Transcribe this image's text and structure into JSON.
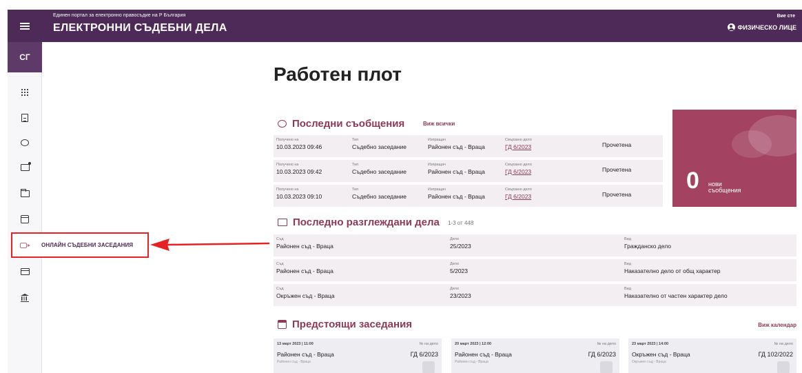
{
  "header": {
    "subtitle": "Единен портал за електронно правосъдие на Р България",
    "title": "ЕЛЕКТРОННИ СЪДЕБНИ ДЕЛА",
    "user_prefix": "Вие сте",
    "user_role": "ФИЗИЧЕСКО ЛИЦЕ"
  },
  "sidebar": {
    "avatar": "СГ",
    "highlighted_label": "ОНЛАЙН СЪДЕБНИ ЗАСЕДАНИЯ",
    "icons": [
      "grid-icon",
      "document-icon",
      "chat-bubble-icon",
      "folder-plus-icon",
      "folder-icon",
      "calendar-icon",
      "video-icon",
      "card-icon",
      "bank-icon"
    ]
  },
  "main": {
    "page_title": "Работен плот",
    "messages": {
      "title": "Последни съобщения",
      "view_all": "Виж всички",
      "col_labels": {
        "received": "Получено на",
        "type": "Тип",
        "sender": "Изпращач",
        "case": "Свързано дело"
      },
      "rows": [
        {
          "received": "10.03.2023 09:46",
          "type": "Съдебно заседание",
          "sender": "Районен съд - Враца",
          "case": "ГД 6/2023",
          "status": "Прочетена"
        },
        {
          "received": "10.03.2023 09:42",
          "type": "Съдебно заседание",
          "sender": "Районен съд - Враца",
          "case": "ГД 6/2023",
          "status": "Прочетена"
        },
        {
          "received": "10.03.2023 09:10",
          "type": "Съдебно заседание",
          "sender": "Районен съд - Враца",
          "case": "ГД 6/2023",
          "status": "Прочетена"
        }
      ],
      "new_count": "0",
      "new_label_1": "нови",
      "new_label_2": "съобщения"
    },
    "cases": {
      "title": "Последно разглеждани дела",
      "range": "1-3 от 448",
      "col_labels": {
        "court": "Съд",
        "case": "Дело",
        "kind": "Вид"
      },
      "rows": [
        {
          "court": "Районен съд - Враца",
          "case": "25/2023",
          "kind": "Гражданско дело"
        },
        {
          "court": "Районен съд - Враца",
          "case": "5/2023",
          "kind": "Наказателно дело от общ характер"
        },
        {
          "court": "Окръжен съд - Враца",
          "case": "23/2023",
          "kind": "Наказателно от частен характер дело"
        }
      ]
    },
    "hearings": {
      "title": "Предстоящи заседания",
      "view_calendar": "Виж календар",
      "case_no_label": "№ на дело",
      "items": [
        {
          "datetime": "13 март 2023 | 11:00",
          "court": "Районен съд - Враца",
          "case": "ГД 6/2023",
          "small": "Районен съд - Враца"
        },
        {
          "datetime": "20 март 2023 | 12:00",
          "court": "Районен съд - Враца",
          "case": "ГД 6/2023",
          "small": "Районен съд - Враца"
        },
        {
          "datetime": "23 март 2023 | 14:00",
          "court": "Окръжен съд - Враца",
          "case": "ГД 102/2022",
          "small": "Окръжен съд - Враца"
        }
      ]
    }
  },
  "colors": {
    "header": "#4d2a57",
    "accent": "#8e3a55",
    "card": "#a34261",
    "highlight": "#e62222"
  }
}
